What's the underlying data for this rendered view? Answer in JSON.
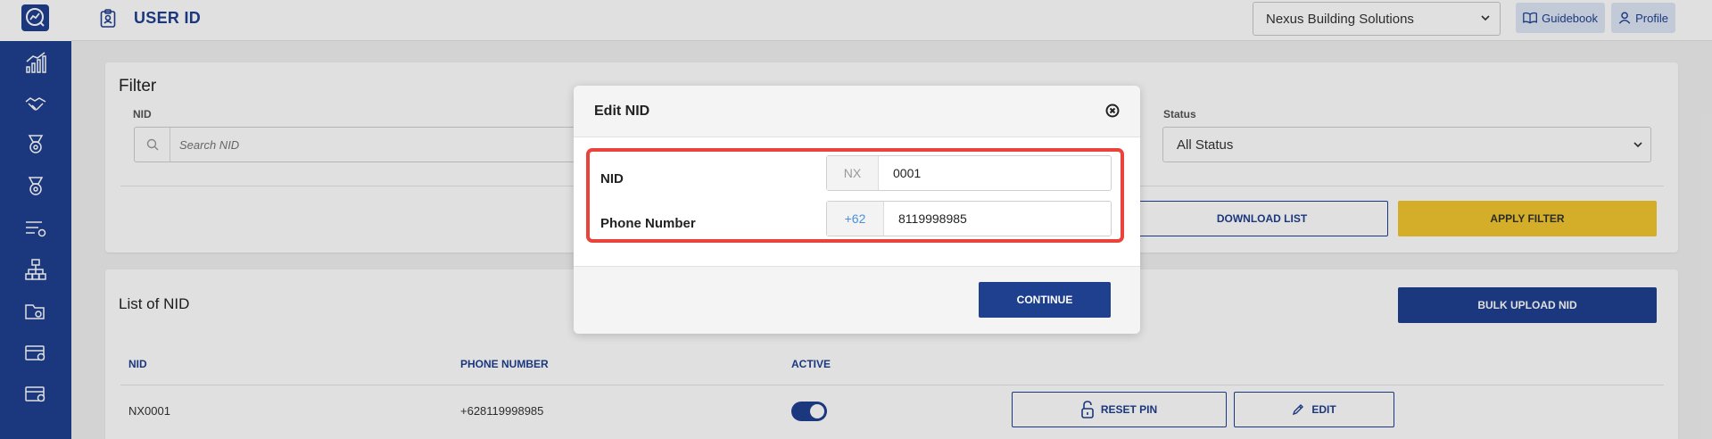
{
  "header": {
    "title": "USER ID",
    "company_select": "Nexus Building Solutions",
    "guidebook_label": "Guidebook",
    "profile_label": "Profile"
  },
  "sidebar": {
    "items": [
      {
        "icon": "chart-growth-icon"
      },
      {
        "icon": "handshake-icon"
      },
      {
        "icon": "medal-icon"
      },
      {
        "icon": "medal-icon"
      },
      {
        "icon": "list-settings-icon"
      },
      {
        "icon": "org-chart-icon"
      },
      {
        "icon": "folder-settings-icon"
      },
      {
        "icon": "card-settings-icon"
      },
      {
        "icon": "card-settings-icon"
      }
    ]
  },
  "filter": {
    "title": "Filter",
    "nid_label": "NID",
    "search_placeholder": "Search NID",
    "status_label": "Status",
    "status_value": "All Status",
    "download_label": "DOWNLOAD LIST",
    "apply_label": "APPLY FILTER"
  },
  "list": {
    "title": "List of NID",
    "bulk_upload_label": "BULK UPLOAD NID",
    "columns": [
      "NID",
      "PHONE NUMBER",
      "ACTIVE"
    ],
    "rows": [
      {
        "nid": "NX0001",
        "phone": "+628119998985",
        "active": true,
        "reset_pin_label": "RESET PIN",
        "edit_label": "EDIT"
      }
    ]
  },
  "modal": {
    "title": "Edit NID",
    "nid_label": "NID",
    "nid_prefix": "NX",
    "nid_value": "0001",
    "phone_label": "Phone Number",
    "phone_prefix": "+62",
    "phone_value": "8119998985",
    "continue_label": "CONTINUE"
  },
  "colors": {
    "primary": "#1f3f8f",
    "accent_yellow": "#f2c62f",
    "highlight_red": "#e9433c",
    "prefix_blue": "#4a90d9"
  }
}
